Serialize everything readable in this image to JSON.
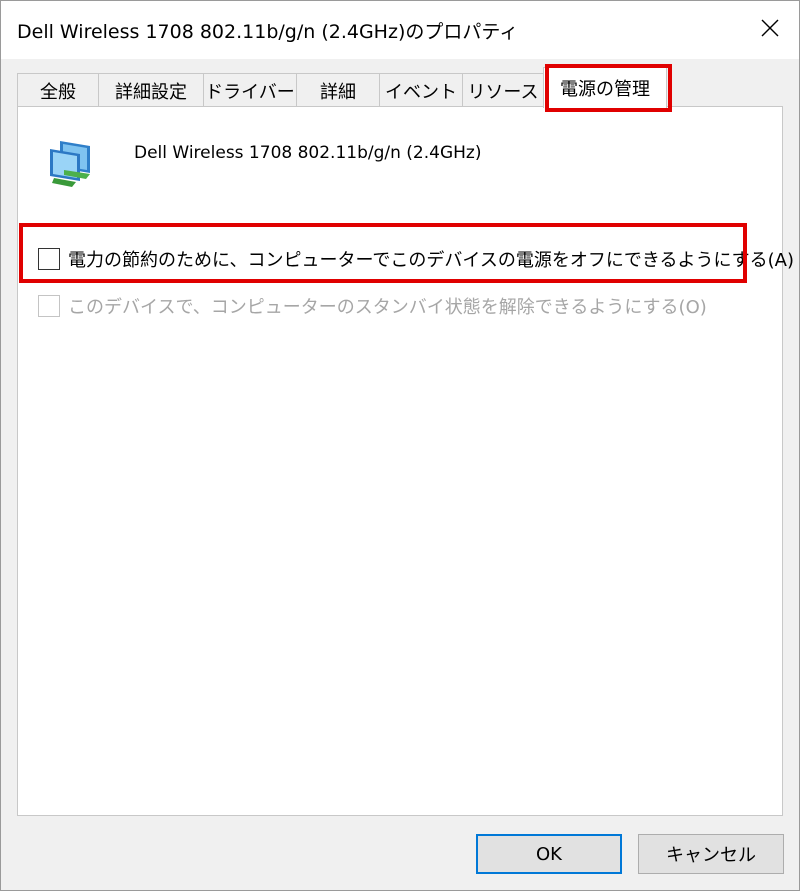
{
  "window": {
    "title": "Dell Wireless 1708 802.11b/g/n (2.4GHz)のプロパティ"
  },
  "tabs": [
    {
      "label": "全般"
    },
    {
      "label": "詳細設定"
    },
    {
      "label": "ドライバー"
    },
    {
      "label": "詳細"
    },
    {
      "label": "イベント"
    },
    {
      "label": "リソース"
    },
    {
      "label": "電源の管理",
      "active": true
    }
  ],
  "panel": {
    "device_icon": "network-adapter-icon",
    "device_name": "Dell Wireless 1708 802.11b/g/n (2.4GHz)",
    "options": [
      {
        "label": "電力の節約のために、コンピューターでこのデバイスの電源をオフにできるようにする(A)",
        "checked": false,
        "enabled": true
      },
      {
        "label": "このデバイスで、コンピューターのスタンバイ状態を解除できるようにする(O)",
        "checked": false,
        "enabled": false
      }
    ]
  },
  "buttons": {
    "ok": "OK",
    "cancel": "キャンセル"
  },
  "colors": {
    "highlight": "#e00000",
    "default_button_border": "#0078d7"
  }
}
